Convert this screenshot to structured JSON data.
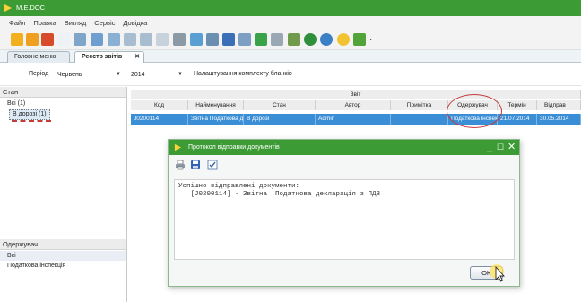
{
  "app": {
    "title": "M.E.DOC"
  },
  "menu": [
    "Файл",
    "Правка",
    "Вигляд",
    "Сервіс",
    "Довідка"
  ],
  "toolbar": {
    "icons": [
      "arrow-right-icon",
      "folder-open-icon",
      "delete-icon",
      "new-doc-icon",
      "copy-doc-icon",
      "refresh-icon",
      "view-icon",
      "list-icon",
      "list2-icon",
      "save-icon",
      "print-icon",
      "chart-icon",
      "search-icon",
      "tools-icon",
      "checklist-icon",
      "filter-icon",
      "filter2-icon",
      "structure-icon",
      "sync-icon",
      "globe-icon",
      "help-icon",
      "send-icon"
    ]
  },
  "tabs": [
    {
      "label": "Головне меню"
    },
    {
      "label": "Реєстр звітів",
      "active": true,
      "close": "✕"
    }
  ],
  "filter": {
    "period_label": "Період",
    "month": "Червень",
    "year": "2014",
    "forms_settings": "Налаштування комплекту бланків"
  },
  "left_panel": {
    "state_header": "Стан",
    "state_items": [
      "Всі (1)",
      "В дорозі (1)"
    ],
    "recipient_header": "Одержувач",
    "recipient_items": [
      "Всі",
      "Податкова інспекція"
    ]
  },
  "grid": {
    "group_header": "Звіт",
    "columns": [
      "Код",
      "Найменування",
      "Стан",
      "Автор",
      "Примітка",
      "Одержувач",
      "Термін",
      "Відправ"
    ],
    "rows": [
      [
        "J0200114",
        "Звітна Податкова де",
        "В дорозі",
        "Admin",
        "",
        "Податкова інспекц",
        "21.07.2014",
        "30.05.2014"
      ]
    ]
  },
  "dialog": {
    "title": "Протокол відправки документів",
    "controls": {
      "minimize": "_",
      "maximize": "☐",
      "close": "✕"
    },
    "message_lines": [
      "Успішно відправлені документи:",
      "   [J0200114] - Звітна  Податкова декларація з ПДВ"
    ],
    "ok_label": "OK"
  },
  "colors": {
    "titlebar": "#3d9b35",
    "selection": "#3a8ed6",
    "annotation": "#c73a3a"
  }
}
